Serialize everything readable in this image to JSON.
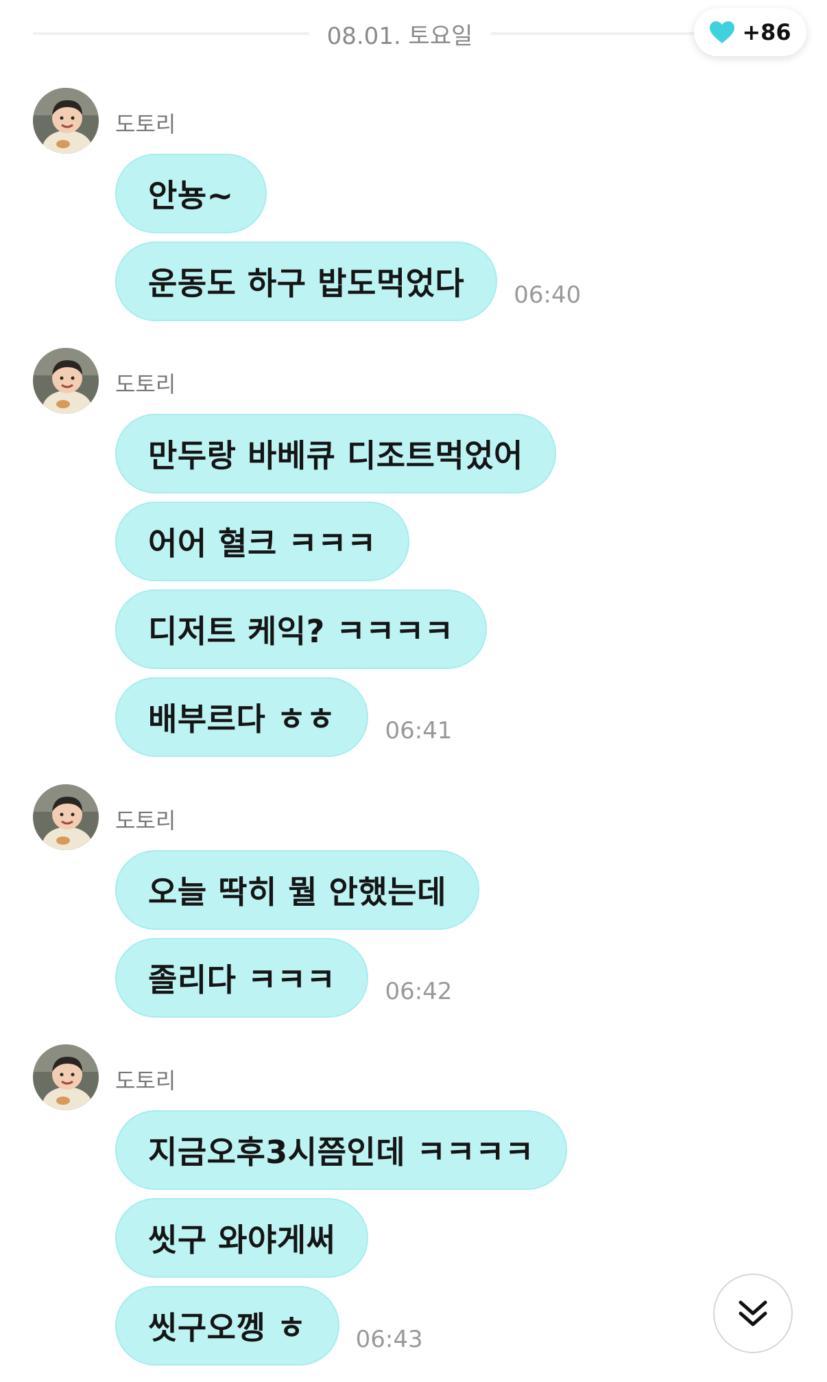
{
  "header": {
    "date": "08.01. 토요일",
    "heart_count": "+86"
  },
  "colors": {
    "bubble": "#bef3f4",
    "heart": "#3fd1dc"
  },
  "groups": [
    {
      "sender": "도토리",
      "messages": [
        {
          "text": "안뇽~",
          "time": ""
        },
        {
          "text": "운동도 하구 밥도먹었다",
          "time": "06:40"
        }
      ]
    },
    {
      "sender": "도토리",
      "messages": [
        {
          "text": "만두랑 바베큐 디조트먹었어",
          "time": ""
        },
        {
          "text": "어어 혈크 ㅋㅋㅋ",
          "time": ""
        },
        {
          "text": "디저트 케익? ㅋㅋㅋㅋ",
          "time": ""
        },
        {
          "text": "배부르다 ㅎㅎ",
          "time": "06:41"
        }
      ]
    },
    {
      "sender": "도토리",
      "messages": [
        {
          "text": "오늘 딱히 뭘 안했는데",
          "time": ""
        },
        {
          "text": "졸리다 ㅋㅋㅋ",
          "time": "06:42"
        }
      ]
    },
    {
      "sender": "도토리",
      "messages": [
        {
          "text": "지금오후3시쯤인데 ㅋㅋㅋㅋ",
          "time": ""
        },
        {
          "text": "씻구 와야게써",
          "time": ""
        },
        {
          "text": "씻구오껭 ㅎ",
          "time": "06:43"
        }
      ]
    }
  ],
  "icons": {
    "heart": "heart-icon",
    "scroll": "double-chevron-down-icon"
  }
}
